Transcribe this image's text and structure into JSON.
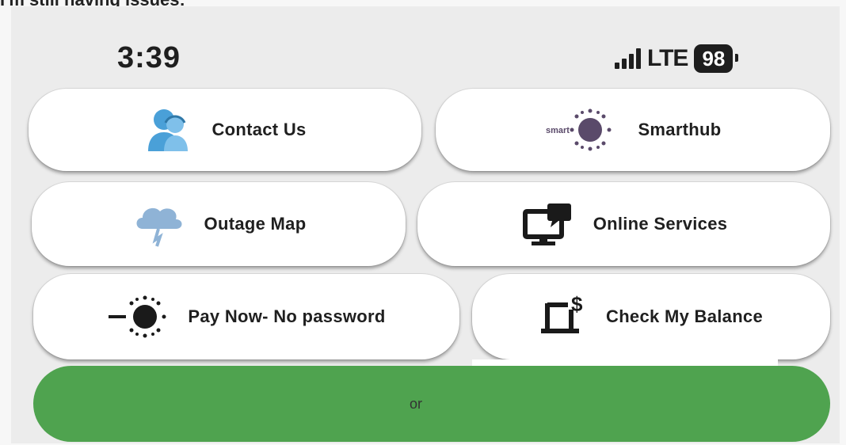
{
  "caption": "I'm still having issues:",
  "status_bar": {
    "time": "3:39",
    "network": "LTE",
    "battery": "98"
  },
  "buttons": {
    "contact_us": "Contact Us",
    "smarthub": "Smarthub",
    "outage_map": "Outage Map",
    "online_services": "Online Services",
    "pay_now": "Pay Now- No password",
    "check_balance": "Check My Balance"
  },
  "icons": {
    "contact_us": "support-agent-icon",
    "smarthub": "smarthub-sun-icon",
    "smarthub_badge": "smart",
    "outage_map": "storm-cloud-icon",
    "online_services": "monitor-chat-icon",
    "pay_now": "smarthub-sun-icon",
    "check_balance": "laptop-dollar-icon",
    "check_balance_symbol": "$"
  },
  "footer_button": {
    "label": "or"
  },
  "colors": {
    "green": "#4fa34f",
    "contact_icon": "#4aa0d8",
    "smarthub_icon": "#5a4a6a"
  }
}
